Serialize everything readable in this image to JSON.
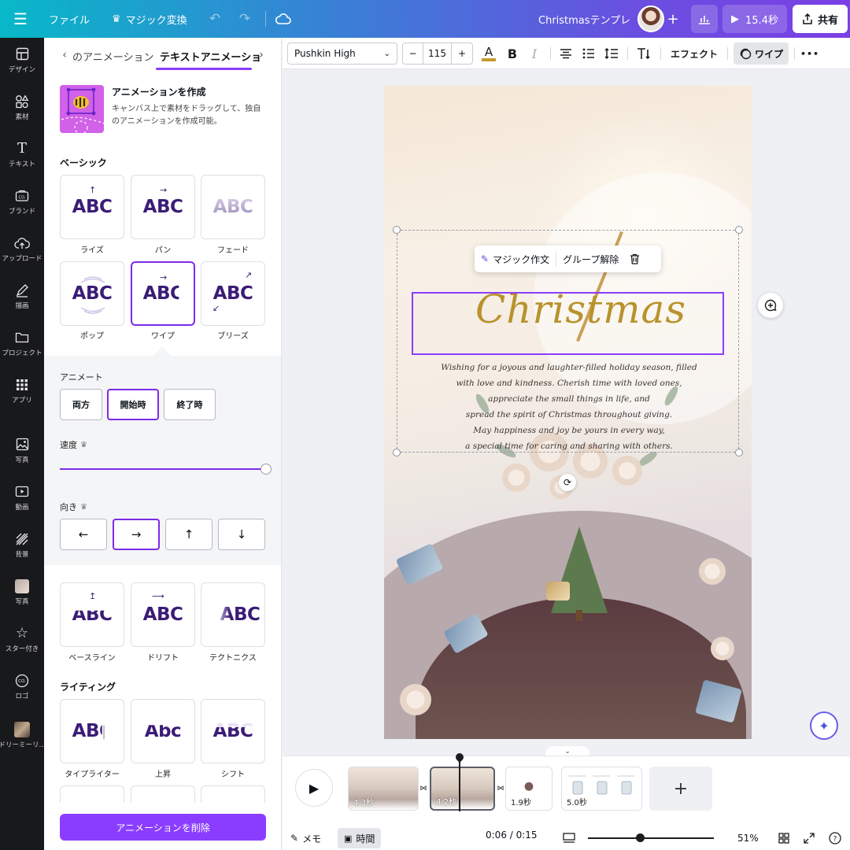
{
  "topbar": {
    "file": "ファイル",
    "magic": "マジック変換",
    "doc_title": "Christmasテンプレ",
    "play_duration": "15.4秒",
    "share": "共有"
  },
  "rail": [
    {
      "label": "デザイン",
      "icon": "layout-icon"
    },
    {
      "label": "素材",
      "icon": "elements-icon"
    },
    {
      "label": "テキスト",
      "icon": "text-icon"
    },
    {
      "label": "ブランド",
      "icon": "brand-icon"
    },
    {
      "label": "アップロード",
      "icon": "upload-icon"
    },
    {
      "label": "描画",
      "icon": "draw-icon"
    },
    {
      "label": "プロジェクト",
      "icon": "folder-icon"
    },
    {
      "label": "アプリ",
      "icon": "apps-icon"
    },
    {
      "label": "写真",
      "icon": "photo-icon"
    },
    {
      "label": "動画",
      "icon": "video-icon"
    },
    {
      "label": "背景",
      "icon": "background-icon"
    },
    {
      "label": "写真",
      "icon": "photo-thumb-icon"
    },
    {
      "label": "スター付き",
      "icon": "star-icon"
    },
    {
      "label": "ロゴ",
      "icon": "logo-icon"
    },
    {
      "label": "ドリーミーリ...",
      "icon": "dreamy-thumb-icon"
    }
  ],
  "panel": {
    "tab_prev": "のアニメーション",
    "tab_active": "テキストアニメーショ",
    "create_title": "アニメーションを作成",
    "create_desc": "キャンバス上で素材をドラッグして、独自のアニメーションを作成可能。",
    "basic_title": "ベーシック",
    "tile_text": "ABC",
    "basic_tiles": [
      "ライズ",
      "パン",
      "フェード",
      "ポップ",
      "ワイプ",
      "ブリーズ"
    ],
    "animate_label": "アニメート",
    "animate_options": [
      "両方",
      "開始時",
      "終了時"
    ],
    "speed_label": "速度",
    "speed_value": 1.0,
    "direction_label": "向き",
    "direction_arrows": [
      "←",
      "→",
      "↑",
      "↓"
    ],
    "more_tiles": [
      "ベースライン",
      "ドリフト",
      "テクトニクス"
    ],
    "writing_title": "ライティング",
    "writing_tiles": [
      "タイプライター",
      "上昇",
      "シフト"
    ],
    "writing_texts": [
      "ABC",
      "Abc",
      "ABC"
    ],
    "delete_button": "アニメーションを削除"
  },
  "toolbar": {
    "font": "Pushkin High",
    "size": "115",
    "minus": "−",
    "plus": "+",
    "effect": "エフェクト",
    "wipe": "ワイプ",
    "more": "•••"
  },
  "canvas": {
    "title": "Christmas",
    "body_lines": [
      "Wishing for a joyous and laughter-filled holiday season, filled",
      "with love and kindness. Cherish time with loved ones,",
      "appreciate the small things in life, and",
      "spread the spirit of Christmas throughout giving.",
      "May happiness and joy be yours in every way,",
      "a special time for caring and sharing with others."
    ],
    "context_menu": {
      "magic_write": "マジック作文",
      "ungroup": "グループ解除"
    }
  },
  "timeline": {
    "clips": [
      "4.3秒",
      "4.2秒",
      "1.9秒",
      "5.0秒"
    ],
    "current_time": "0:06 / 0:15",
    "memo": "メモ",
    "time_label": "時間",
    "zoom": "51%",
    "zoom_fraction": 0.41
  },
  "colors": {
    "accent": "#8b3dff",
    "title_gold": "#b8922c",
    "abc_purple": "#3b1c76"
  }
}
